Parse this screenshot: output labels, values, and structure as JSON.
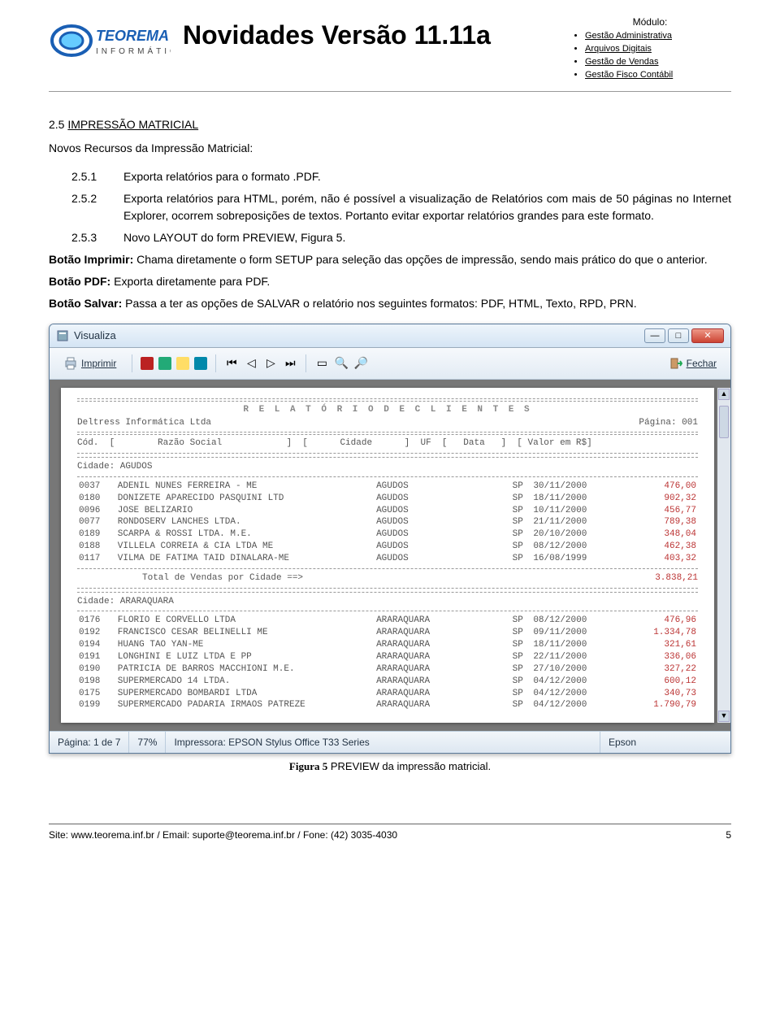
{
  "header": {
    "logo_top": "TEOREMA",
    "logo_sub": "INFORMÁTICA",
    "title": "Novidades Versão 11.11a",
    "module_label": "Módulo:",
    "modules": [
      "Gestão Administrativa",
      "Arquivos Digitais",
      "Gestão de Vendas",
      "Gestão Fisco Contábil"
    ]
  },
  "section": {
    "num": "2.5",
    "title": "IMPRESSÃO MATRICIAL",
    "intro": "Novos Recursos da Impressão Matricial:",
    "items": [
      {
        "num": "2.5.1",
        "text": "Exporta relatórios para o formato .PDF."
      },
      {
        "num": "2.5.2",
        "text": "Exporta relatórios para HTML, porém, não é possível a visualização de Relatórios com mais de 50 páginas no Internet Explorer, ocorrem sobreposições de textos. Portanto evitar exportar relatórios grandes para este formato."
      },
      {
        "num": "2.5.3",
        "text": "Novo LAYOUT do form PREVIEW, Figura 5."
      }
    ],
    "p1_b": "Botão Imprimir:",
    "p1": " Chama diretamente o form SETUP para seleção das opções de impressão, sendo mais prático do que o anterior.",
    "p2_b": "Botão PDF:",
    "p2": " Exporta diretamente para PDF.",
    "p3_b": "Botão Salvar:",
    "p3": " Passa a ter as opções de SALVAR o relatório nos seguintes formatos: PDF, HTML, Texto, RPD, PRN."
  },
  "window": {
    "title": "Visualiza",
    "toolbar": {
      "print": "Imprimir",
      "close": "Fechar"
    },
    "statusbar": {
      "page": "Página: 1 de 7",
      "zoom": "77%",
      "printer_label": "Impressora: EPSON Stylus Office T33 Series",
      "printer_short": "Epson"
    }
  },
  "report": {
    "title": "R E L A T Ó R I O   D E   C L I E N T E S",
    "company": "Deltress Informática Ltda",
    "page": "Página: 001",
    "headers": "Cód.  [        Razão Social            ]  [      Cidade      ]  UF  [   Data   ]  [ Valor em R$]",
    "cities": [
      {
        "name": "AGUDOS",
        "rows": [
          {
            "cod": "0037",
            "razao": "ADENIL NUNES FERREIRA - ME",
            "cidade": "AGUDOS",
            "uf": "SP",
            "data": "30/11/2000",
            "valor": "476,00"
          },
          {
            "cod": "0180",
            "razao": "DONIZETE APARECIDO PASQUINI  LTD",
            "cidade": "AGUDOS",
            "uf": "SP",
            "data": "18/11/2000",
            "valor": "902,32"
          },
          {
            "cod": "0096",
            "razao": "JOSE BELIZARIO",
            "cidade": "AGUDOS",
            "uf": "SP",
            "data": "10/11/2000",
            "valor": "456,77"
          },
          {
            "cod": "0077",
            "razao": "RONDOSERV LANCHES LTDA.",
            "cidade": "AGUDOS",
            "uf": "SP",
            "data": "21/11/2000",
            "valor": "789,38"
          },
          {
            "cod": "0189",
            "razao": "SCARPA & ROSSI LTDA. M.E.",
            "cidade": "AGUDOS",
            "uf": "SP",
            "data": "20/10/2000",
            "valor": "348,04"
          },
          {
            "cod": "0188",
            "razao": "VILLELA CORREIA & CIA LTDA ME",
            "cidade": "AGUDOS",
            "uf": "SP",
            "data": "08/12/2000",
            "valor": "462,38"
          },
          {
            "cod": "0117",
            "razao": "VILMA DE FATIMA TAID DINALARA-ME",
            "cidade": "AGUDOS",
            "uf": "SP",
            "data": "16/08/1999",
            "valor": "403,32"
          }
        ],
        "total_label": "Total de Vendas por Cidade ==>",
        "total": "3.838,21"
      },
      {
        "name": "ARARAQUARA",
        "rows": [
          {
            "cod": "0176",
            "razao": "FLORIO E CORVELLO  LTDA",
            "cidade": "ARARAQUARA",
            "uf": "SP",
            "data": "08/12/2000",
            "valor": "476,96"
          },
          {
            "cod": "0192",
            "razao": "FRANCISCO CESAR BELINELLI ME",
            "cidade": "ARARAQUARA",
            "uf": "SP",
            "data": "09/11/2000",
            "valor": "1.334,78"
          },
          {
            "cod": "0194",
            "razao": "HUANG TAO YAN-ME",
            "cidade": "ARARAQUARA",
            "uf": "SP",
            "data": "18/11/2000",
            "valor": "321,61"
          },
          {
            "cod": "0191",
            "razao": "LONGHINI  E LUIZ LTDA E PP",
            "cidade": "ARARAQUARA",
            "uf": "SP",
            "data": "22/11/2000",
            "valor": "336,06"
          },
          {
            "cod": "0190",
            "razao": "PATRICIA DE BARROS MACCHIONI M.E.",
            "cidade": "ARARAQUARA",
            "uf": "SP",
            "data": "27/10/2000",
            "valor": "327,22"
          },
          {
            "cod": "0198",
            "razao": "SUPERMERCADO 14 LTDA.",
            "cidade": "ARARAQUARA",
            "uf": "SP",
            "data": "04/12/2000",
            "valor": "600,12"
          },
          {
            "cod": "0175",
            "razao": "SUPERMERCADO BOMBARDI LTDA",
            "cidade": "ARARAQUARA",
            "uf": "SP",
            "data": "04/12/2000",
            "valor": "340,73"
          },
          {
            "cod": "0199",
            "razao": "SUPERMERCADO PADARIA IRMAOS PATREZE",
            "cidade": "ARARAQUARA",
            "uf": "SP",
            "data": "04/12/2000",
            "valor": "1.790,79"
          }
        ]
      }
    ]
  },
  "figure": {
    "label": "Figura 5",
    "caption": " PREVIEW da impressão matricial."
  },
  "footer": {
    "left": "Site: www.teorema.inf.br / Email: suporte@teorema.inf.br / Fone: (42) 3035-4030",
    "right": "5"
  }
}
